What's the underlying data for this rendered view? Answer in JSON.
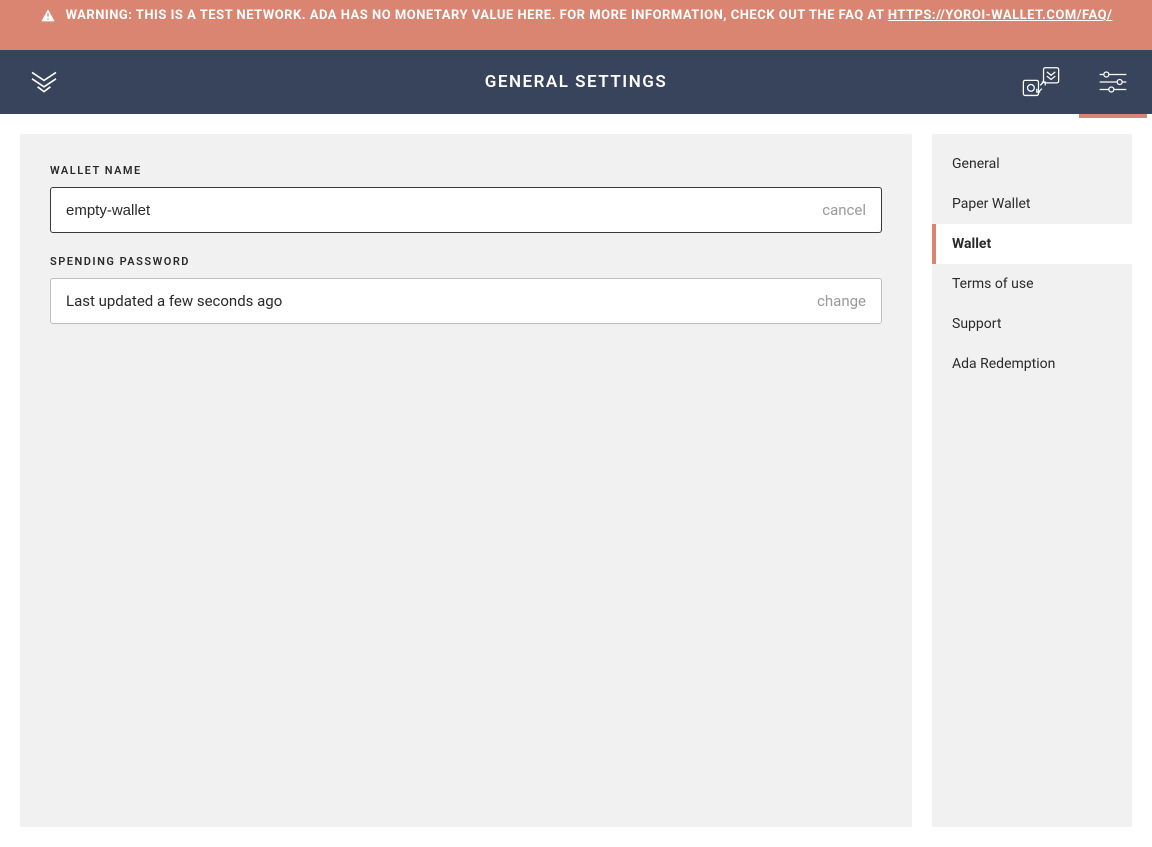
{
  "warning": {
    "text_prefix": "WARNING: THIS IS A TEST NETWORK. ADA HAS NO MONETARY VALUE HERE. FOR MORE INFORMATION, CHECK OUT THE FAQ AT ",
    "link_text": "HTTPS://YOROI-WALLET.COM/FAQ/"
  },
  "header": {
    "title": "GENERAL SETTINGS"
  },
  "wallet_name": {
    "label": "WALLET NAME",
    "value": "empty-wallet",
    "action": "cancel"
  },
  "spending_password": {
    "label": "SPENDING PASSWORD",
    "status": "Last updated a few seconds ago",
    "action": "change"
  },
  "sidebar": {
    "items": [
      {
        "label": "General",
        "active": false
      },
      {
        "label": "Paper Wallet",
        "active": false
      },
      {
        "label": "Wallet",
        "active": true
      },
      {
        "label": "Terms of use",
        "active": false
      },
      {
        "label": "Support",
        "active": false
      },
      {
        "label": "Ada Redemption",
        "active": false
      }
    ]
  }
}
